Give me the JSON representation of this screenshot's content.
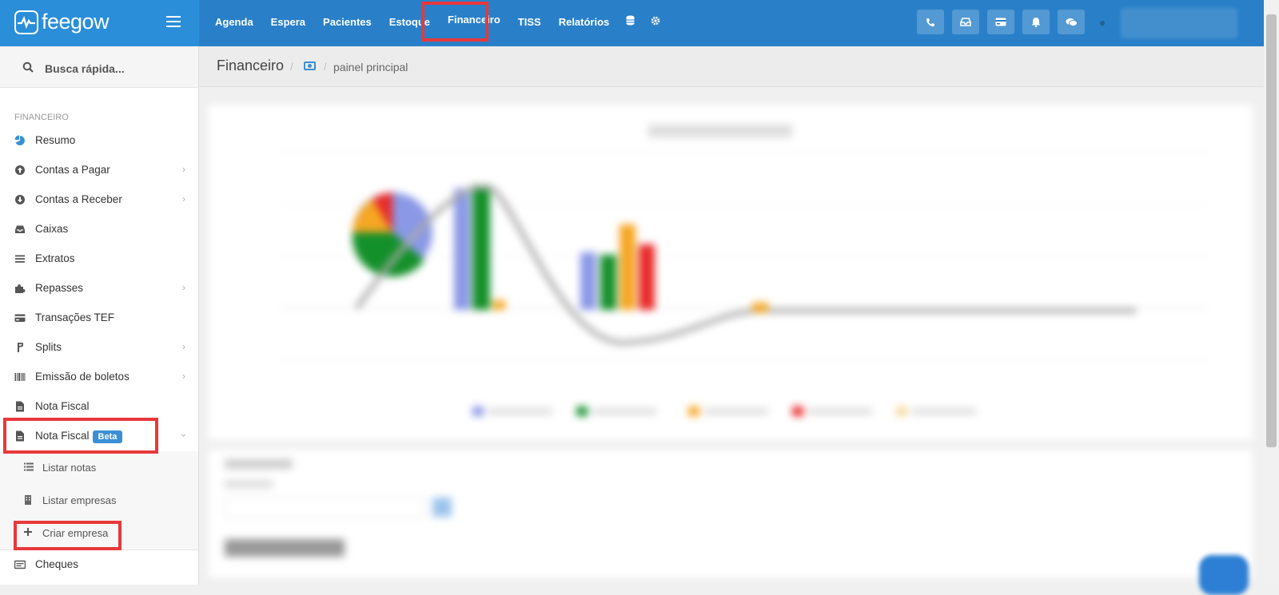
{
  "brand": {
    "name": "feegow"
  },
  "nav": {
    "items": [
      {
        "id": "agenda",
        "label": "Agenda"
      },
      {
        "id": "espera",
        "label": "Espera"
      },
      {
        "id": "pacientes",
        "label": "Pacientes"
      },
      {
        "id": "estoque",
        "label": "Estoque"
      },
      {
        "id": "financeiro",
        "label": "Financeiro"
      },
      {
        "id": "tiss",
        "label": "TISS"
      },
      {
        "id": "relatorios",
        "label": "Relatórios"
      }
    ],
    "extra_icons": [
      "database-icon",
      "gear-icon"
    ],
    "right_icons": [
      "phone-icon",
      "inbox-icon",
      "card-icon",
      "bell-icon",
      "chat-icon"
    ]
  },
  "sidebar": {
    "search_placeholder": "Busca rápida...",
    "section_title": "FINANCEIRO",
    "items": [
      {
        "label": "Resumo",
        "icon": "pie-chart-icon",
        "has_children": false
      },
      {
        "label": "Contas a Pagar",
        "icon": "arrow-up-circle-icon",
        "has_children": true
      },
      {
        "label": "Contas a Receber",
        "icon": "arrow-down-circle-icon",
        "has_children": true
      },
      {
        "label": "Caixas",
        "icon": "inbox-icon",
        "has_children": false
      },
      {
        "label": "Extratos",
        "icon": "list-icon",
        "has_children": false
      },
      {
        "label": "Repasses",
        "icon": "puzzle-icon",
        "has_children": true
      },
      {
        "label": "Transações TEF",
        "icon": "credit-card-icon",
        "has_children": false
      },
      {
        "label": "Splits",
        "icon": "split-icon",
        "has_children": true
      },
      {
        "label": "Emissão de boletos",
        "icon": "barcode-icon",
        "has_children": true
      },
      {
        "label": "Nota Fiscal",
        "icon": "file-icon",
        "has_children": false
      },
      {
        "label": "Nota Fiscal",
        "icon": "file-icon",
        "has_children": true,
        "badge": "Beta",
        "expanded": true
      }
    ],
    "submenu": [
      {
        "label": "Listar notas",
        "icon": "list-icon"
      },
      {
        "label": "Listar empresas",
        "icon": "building-icon"
      },
      {
        "label": "Criar empresa",
        "icon": "plus-icon"
      }
    ],
    "after": [
      {
        "label": "Cheques",
        "icon": "money-icon"
      }
    ]
  },
  "breadcrumb": {
    "title": "Financeiro",
    "icon": "money-icon",
    "page": "painel principal"
  },
  "colors": {
    "header": "#2980c8",
    "brand_bg": "#2a8ed8",
    "highlight": "#e8383b",
    "badge": "#3a8fd6"
  }
}
